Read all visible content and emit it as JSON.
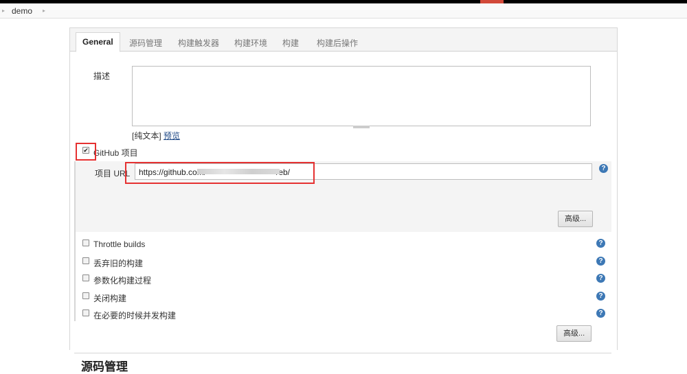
{
  "breadcrumb": {
    "items": [
      "demo"
    ]
  },
  "tabs": [
    {
      "label": "General"
    },
    {
      "label": "源码管理"
    },
    {
      "label": "构建触发器"
    },
    {
      "label": "构建环境"
    },
    {
      "label": "构建"
    },
    {
      "label": "构建后操作"
    }
  ],
  "description": {
    "label": "描述",
    "value": "",
    "format_prefix": "[纯文本]",
    "preview_link": "预览"
  },
  "github_project": {
    "checkbox_label": "GitHub 项目",
    "checked": true,
    "url_label": "项目 URL",
    "url_visible_start": "https://github.com/",
    "url_visible_end": "/eb/",
    "advanced_button": "高级..."
  },
  "options": [
    {
      "label": "Throttle builds",
      "checked": false
    },
    {
      "label": "丢弃旧的构建",
      "checked": false
    },
    {
      "label": "参数化构建过程",
      "checked": false
    },
    {
      "label": "关闭构建",
      "checked": false
    },
    {
      "label": "在必要的时候并发构建",
      "checked": false
    }
  ],
  "advanced_button_2": "高级...",
  "next_section_title": "源码管理",
  "icons": {
    "help": "?",
    "check": "✔"
  },
  "colors": {
    "accent_red": "#d24939",
    "help_blue": "#3d78b5",
    "highlight_box": "#e53030"
  }
}
